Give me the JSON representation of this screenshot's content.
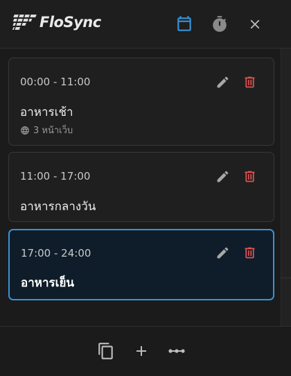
{
  "app": {
    "name": "FloSync"
  },
  "header": {
    "icons": [
      "flosync-logo",
      "calendar-icon",
      "timer-icon",
      "close-icon"
    ],
    "active_icon": "calendar-icon"
  },
  "schedule": {
    "items": [
      {
        "time": "00:00 - 11:00",
        "name": "อาหารเช้า",
        "meta": "3 หน้าเว็บ",
        "selected": false
      },
      {
        "time": "11:00 - 17:00",
        "name": "อาหารกลางวัน",
        "selected": false
      },
      {
        "time": "17:00 - 24:00",
        "name": "อาหารเย็น",
        "selected": true
      }
    ]
  },
  "footer": {
    "icons": [
      "copy-icon",
      "add-icon",
      "more-icon"
    ]
  },
  "colors": {
    "accent": "#3a93d6",
    "delete": "#e05252",
    "background": "#1b1b1b"
  }
}
